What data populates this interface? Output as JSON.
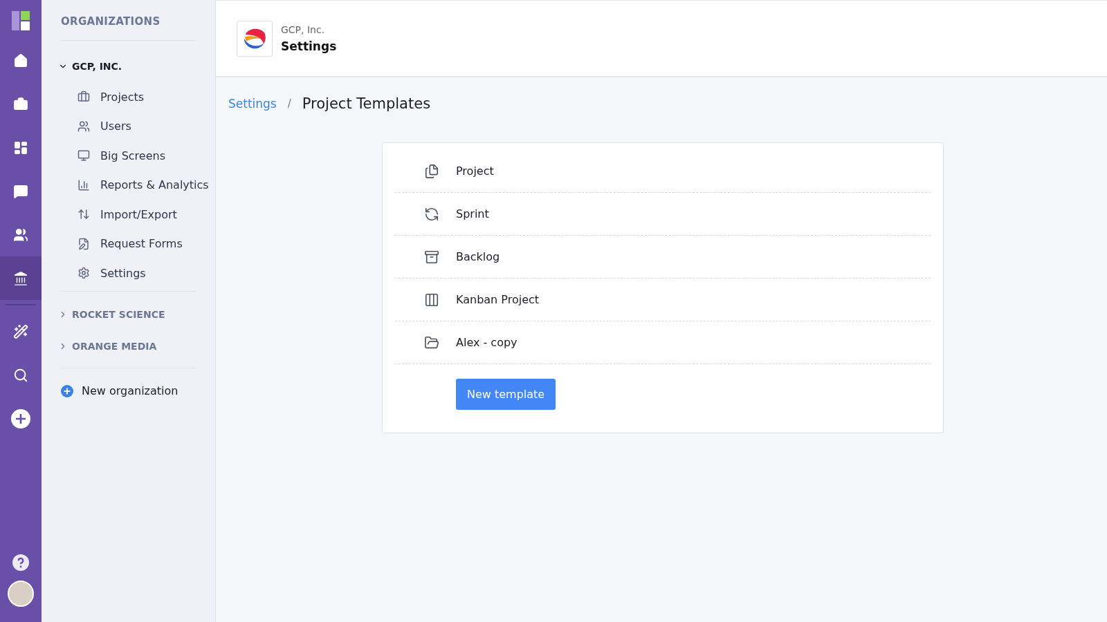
{
  "rail": {
    "items": [
      {
        "selected": false
      },
      {
        "selected": false
      },
      {
        "selected": false
      },
      {
        "selected": false
      },
      {
        "selected": false
      },
      {
        "selected": true
      }
    ],
    "tools": [
      {
        "selected": false
      },
      {
        "selected": false
      },
      {
        "selected": false
      }
    ]
  },
  "sidebar": {
    "title": "ORGANIZATIONS",
    "organizations": [
      {
        "name": "GCP, INC.",
        "expanded": true,
        "children": [
          {
            "label": "Projects"
          },
          {
            "label": "Users"
          },
          {
            "label": "Big Screens"
          },
          {
            "label": "Reports & Analytics"
          },
          {
            "label": "Import/Export"
          },
          {
            "label": "Request Forms"
          },
          {
            "label": "Settings"
          }
        ]
      },
      {
        "name": "ROCKET SCIENCE",
        "expanded": false
      },
      {
        "name": "ORANGE MEDIA",
        "expanded": false
      }
    ],
    "new_organization": "New organization"
  },
  "header": {
    "organization": "GCP, Inc.",
    "title": "Settings"
  },
  "breadcrumb": {
    "link": "Settings",
    "separator": "/",
    "current": "Project Templates"
  },
  "templates": [
    {
      "name": "Project"
    },
    {
      "name": "Sprint"
    },
    {
      "name": "Backlog"
    },
    {
      "name": "Kanban Project"
    },
    {
      "name": "Alex - copy"
    }
  ],
  "new_template_button": "New template"
}
